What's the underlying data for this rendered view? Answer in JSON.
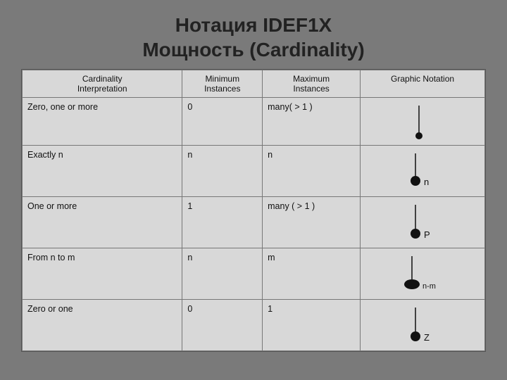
{
  "title": {
    "line1": "Нотация IDEF1X",
    "line2": "Мощность (Cardinality)"
  },
  "table": {
    "headers": {
      "col1": "Cardinality Interpretation",
      "col2": "Minimum Instances",
      "col3": "Maximum Instances",
      "col4": "Graphic Notation"
    },
    "rows": [
      {
        "interpretation": "Zero, one or more",
        "min": "0",
        "max": "many( > 1 )",
        "graphic": "zero-one-or-more"
      },
      {
        "interpretation": "Exactly n",
        "min": "n",
        "max": "n",
        "graphic": "exactly-n"
      },
      {
        "interpretation": "One or more",
        "min": "1",
        "max": "many ( > 1 )",
        "graphic": "one-or-more"
      },
      {
        "interpretation": "From n to m",
        "min": "n",
        "max": "m",
        "graphic": "from-n-to-m"
      },
      {
        "interpretation": "Zero or one",
        "min": "0",
        "max": "1",
        "graphic": "zero-or-one"
      }
    ]
  }
}
